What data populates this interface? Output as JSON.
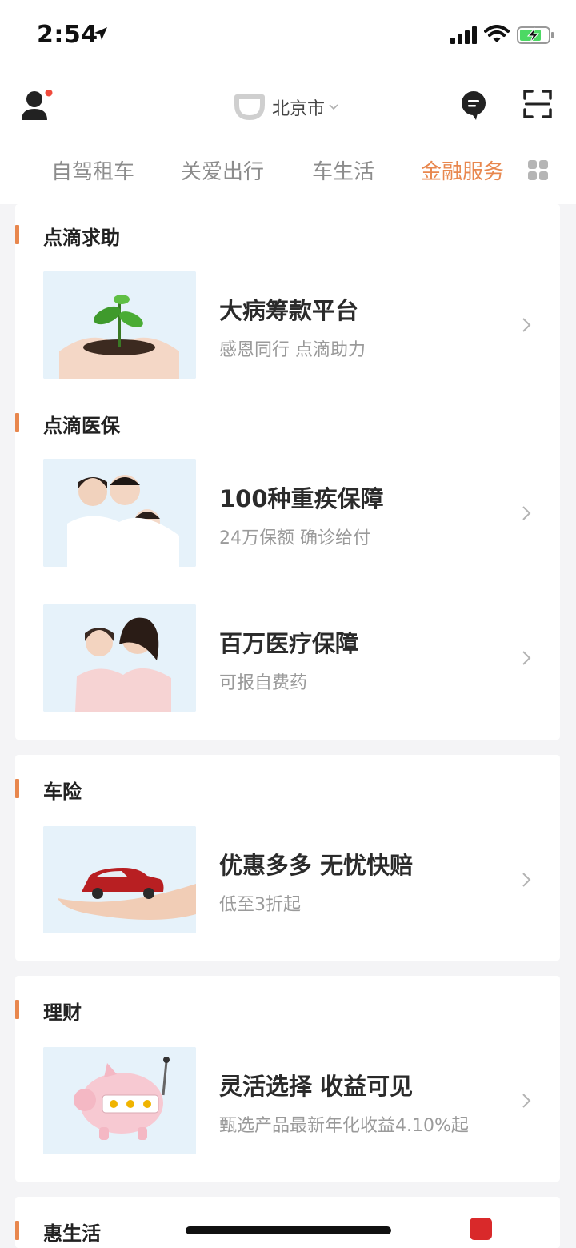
{
  "status_bar": {
    "time": "2:54",
    "icons": [
      "location-arrow-icon",
      "signal-icon",
      "wifi-icon",
      "battery-charging-icon"
    ]
  },
  "header": {
    "city": "北京市",
    "icons": [
      "user-icon",
      "didi-logo-icon",
      "message-icon",
      "scan-icon"
    ]
  },
  "tabs": [
    {
      "label": "自驾租车",
      "active": false
    },
    {
      "label": "关爱出行",
      "active": false
    },
    {
      "label": "车生活",
      "active": false
    },
    {
      "label": "金融服务",
      "active": true
    }
  ],
  "colors": {
    "accent": "#e8874e",
    "background": "#f4f4f6",
    "card": "#ffffff",
    "title_text": "#2b2b2b",
    "sub_text": "#9a9a9a"
  },
  "sections": [
    {
      "title": "点滴求助",
      "items": [
        {
          "title": "大病筹款平台",
          "subtitle": "感恩同行 点滴助力",
          "image": "plant-in-hands"
        }
      ]
    },
    {
      "title": "点滴医保",
      "items": [
        {
          "title": "100种重疾保障",
          "subtitle": "24万保额 确诊给付",
          "image": "family-photo"
        },
        {
          "title": "百万医疗保障",
          "subtitle": "可报自费药",
          "image": "mother-daughter-photo"
        }
      ]
    },
    {
      "title": "车险",
      "items": [
        {
          "title": "优惠多多 无忧快赔",
          "subtitle": "低至3折起",
          "image": "car-in-hand"
        }
      ]
    },
    {
      "title": "理财",
      "items": [
        {
          "title": "灵活选择 收益可见",
          "subtitle": "甄选产品最新年化收益4.10%起",
          "image": "piggy-bank"
        }
      ]
    },
    {
      "title": "惠生活",
      "items": []
    }
  ]
}
